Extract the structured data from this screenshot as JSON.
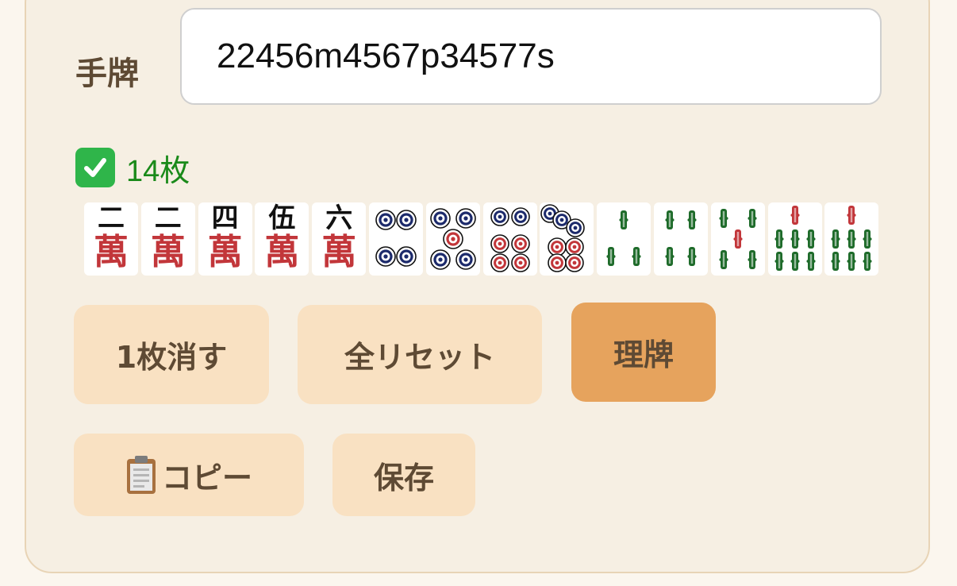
{
  "hand": {
    "label": "手牌",
    "value": "22456m4567p34577s"
  },
  "status": {
    "icon": "check-icon",
    "text": "14枚"
  },
  "tiles": [
    {
      "suit": "m",
      "rank": 2,
      "numeral": "二",
      "suit_char": "萬"
    },
    {
      "suit": "m",
      "rank": 2,
      "numeral": "二",
      "suit_char": "萬"
    },
    {
      "suit": "m",
      "rank": 4,
      "numeral": "四",
      "suit_char": "萬"
    },
    {
      "suit": "m",
      "rank": 5,
      "numeral": "伍",
      "suit_char": "萬"
    },
    {
      "suit": "m",
      "rank": 6,
      "numeral": "六",
      "suit_char": "萬"
    },
    {
      "suit": "p",
      "rank": 4
    },
    {
      "suit": "p",
      "rank": 5
    },
    {
      "suit": "p",
      "rank": 6
    },
    {
      "suit": "p",
      "rank": 7
    },
    {
      "suit": "s",
      "rank": 3
    },
    {
      "suit": "s",
      "rank": 4
    },
    {
      "suit": "s",
      "rank": 5
    },
    {
      "suit": "s",
      "rank": 7
    },
    {
      "suit": "s",
      "rank": 7
    }
  ],
  "buttons": {
    "remove_one": "1枚消す",
    "reset_all": "全リセット",
    "sort": "理牌",
    "copy": "コピー",
    "save": "保存"
  },
  "colors": {
    "accent": "#e6a35d",
    "button_bg": "#f9e1c2",
    "man_red": "#c2363a",
    "sou_green": "#1e6b2a",
    "pin_blue": "#1c2a6b"
  }
}
